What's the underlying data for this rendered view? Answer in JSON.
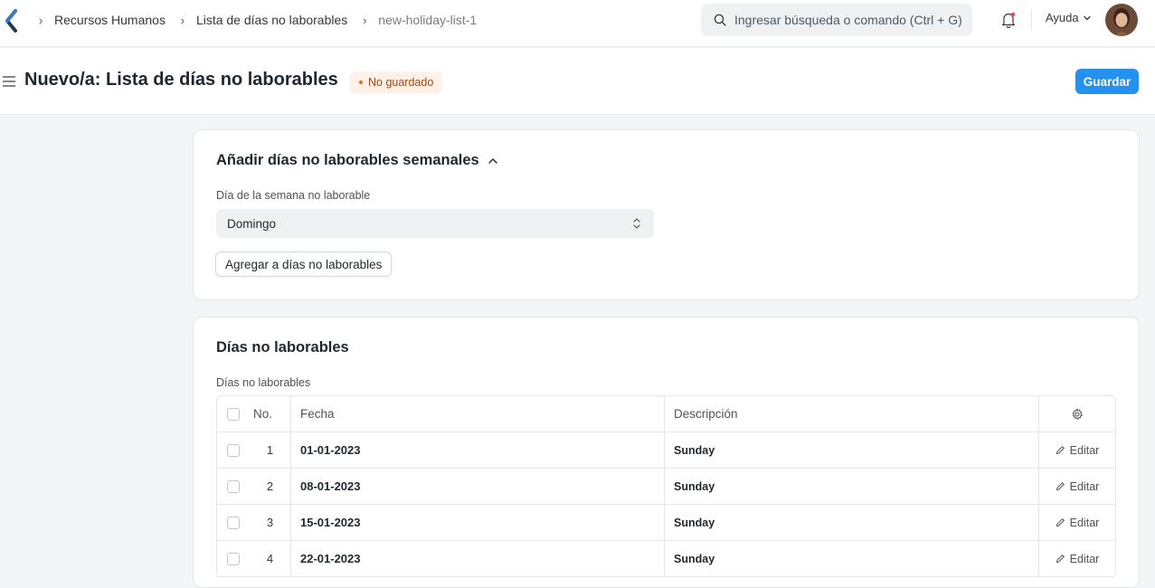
{
  "navbar": {
    "breadcrumbs": [
      "Recursos Humanos",
      "Lista de días no laborables",
      "new-holiday-list-1"
    ],
    "search_placeholder": "Ingresar búsqueda o comando (Ctrl + G)",
    "help_label": "Ayuda",
    "icons": [
      "app-logo",
      "chevron-right-icon",
      "search-icon",
      "bell-icon",
      "chevron-down-icon",
      "avatar"
    ]
  },
  "page_header": {
    "title": "Nuevo/a: Lista de días no laborables",
    "status_badge": "No guardado",
    "save_label": "Guardar",
    "accent_color": "#2490ef",
    "badge_color": "#fff1e7"
  },
  "weekly_section": {
    "title": "Añadir días no laborables semanales",
    "weekday_label": "Día de la semana no laborable",
    "weekday_value": "Domingo",
    "add_button_label": "Agregar a días no laborables"
  },
  "holidays_section": {
    "title": "Días no laborables",
    "table_label": "Días no laborables",
    "columns": {
      "no": "No.",
      "date": "Fecha",
      "description": "Descripción"
    },
    "edit_label": "Editar",
    "rows": [
      {
        "no": "1",
        "date": "01-01-2023",
        "description": "Sunday"
      },
      {
        "no": "2",
        "date": "08-01-2023",
        "description": "Sunday"
      },
      {
        "no": "3",
        "date": "15-01-2023",
        "description": "Sunday"
      },
      {
        "no": "4",
        "date": "22-01-2023",
        "description": "Sunday"
      }
    ]
  }
}
